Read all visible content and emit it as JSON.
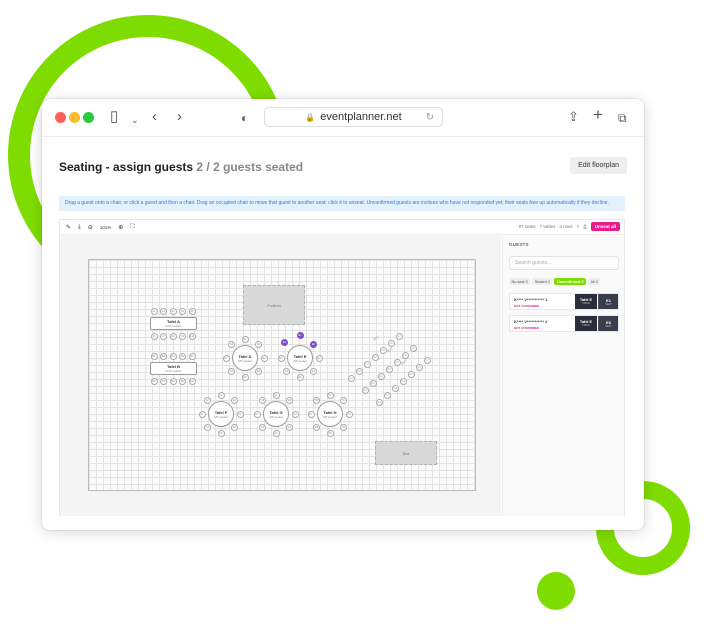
{
  "browser": {
    "url": "eventplanner.net",
    "icons": {
      "sidebar": "sidebar-icon",
      "back": "chevron-left-icon",
      "forward": "chevron-right-icon",
      "shield": "shield-icon",
      "share": "share-icon",
      "new_tab": "plus-icon",
      "tabs": "tabs-icon"
    }
  },
  "page": {
    "title": "Seating - assign guests",
    "guests_seated": "2 / 2 guests seated",
    "edit_button": "Edit floorplan",
    "info": "Drag a guest onto a chair, or click a guest and then a chair. Drag an occupied chair to move that guest to another seat; click it to unseat. Unconfirmed guests are invitees who have not responded yet; their seats free up automatically if they decline."
  },
  "editor": {
    "zoom": "101%",
    "stats": "87 seats · 7 tables · 3 rows",
    "help": "?",
    "unseat_all": "Unseat all"
  },
  "floorplan": {
    "podium": "Podium",
    "bar": "Bar",
    "tables": [
      {
        "name": "Tafel A",
        "sub": "0/10 seated"
      },
      {
        "name": "Tafel B",
        "sub": "0/10 seated"
      },
      {
        "name": "Tafel D",
        "sub": "0/8 seated"
      },
      {
        "name": "Tafel E",
        "sub": "2/8 seated"
      },
      {
        "name": "Tafel F",
        "sub": "0/8 seated"
      },
      {
        "name": "Tafel G",
        "sub": "0/8 seated"
      },
      {
        "name": "Tafel H",
        "sub": "0/8 seated"
      }
    ],
    "rows": [
      "Rij 1",
      "Rij 2",
      "Rij 3"
    ],
    "occupied_seats": [
      "E1",
      "E2"
    ]
  },
  "guests_panel": {
    "title": "GUESTS",
    "search_placeholder": "Search guests...",
    "filters": [
      {
        "label": "No seat 0",
        "active": false
      },
      {
        "label": "Seated 2",
        "active": false
      },
      {
        "label": "Unconfirmed 2",
        "active": true
      },
      {
        "label": "All 2",
        "active": false
      }
    ],
    "guests": [
      {
        "name": "K**** V*********** 1",
        "status": "NOT CONFIRMED",
        "table": "Tafel E",
        "table_sub": "TABLE",
        "seat": "E1",
        "seat_sub": "SEAT"
      },
      {
        "name": "K**** V*********** 2",
        "status": "NOT CONFIRMED",
        "table": "Tafel E",
        "table_sub": "TABLE",
        "seat": "E6",
        "seat_sub": "SEAT"
      }
    ]
  },
  "colors": {
    "accent": "#7fdc00",
    "pink": "#e91e8c",
    "occupied": "#7a4ec8",
    "dark": "#2b2d3a"
  }
}
